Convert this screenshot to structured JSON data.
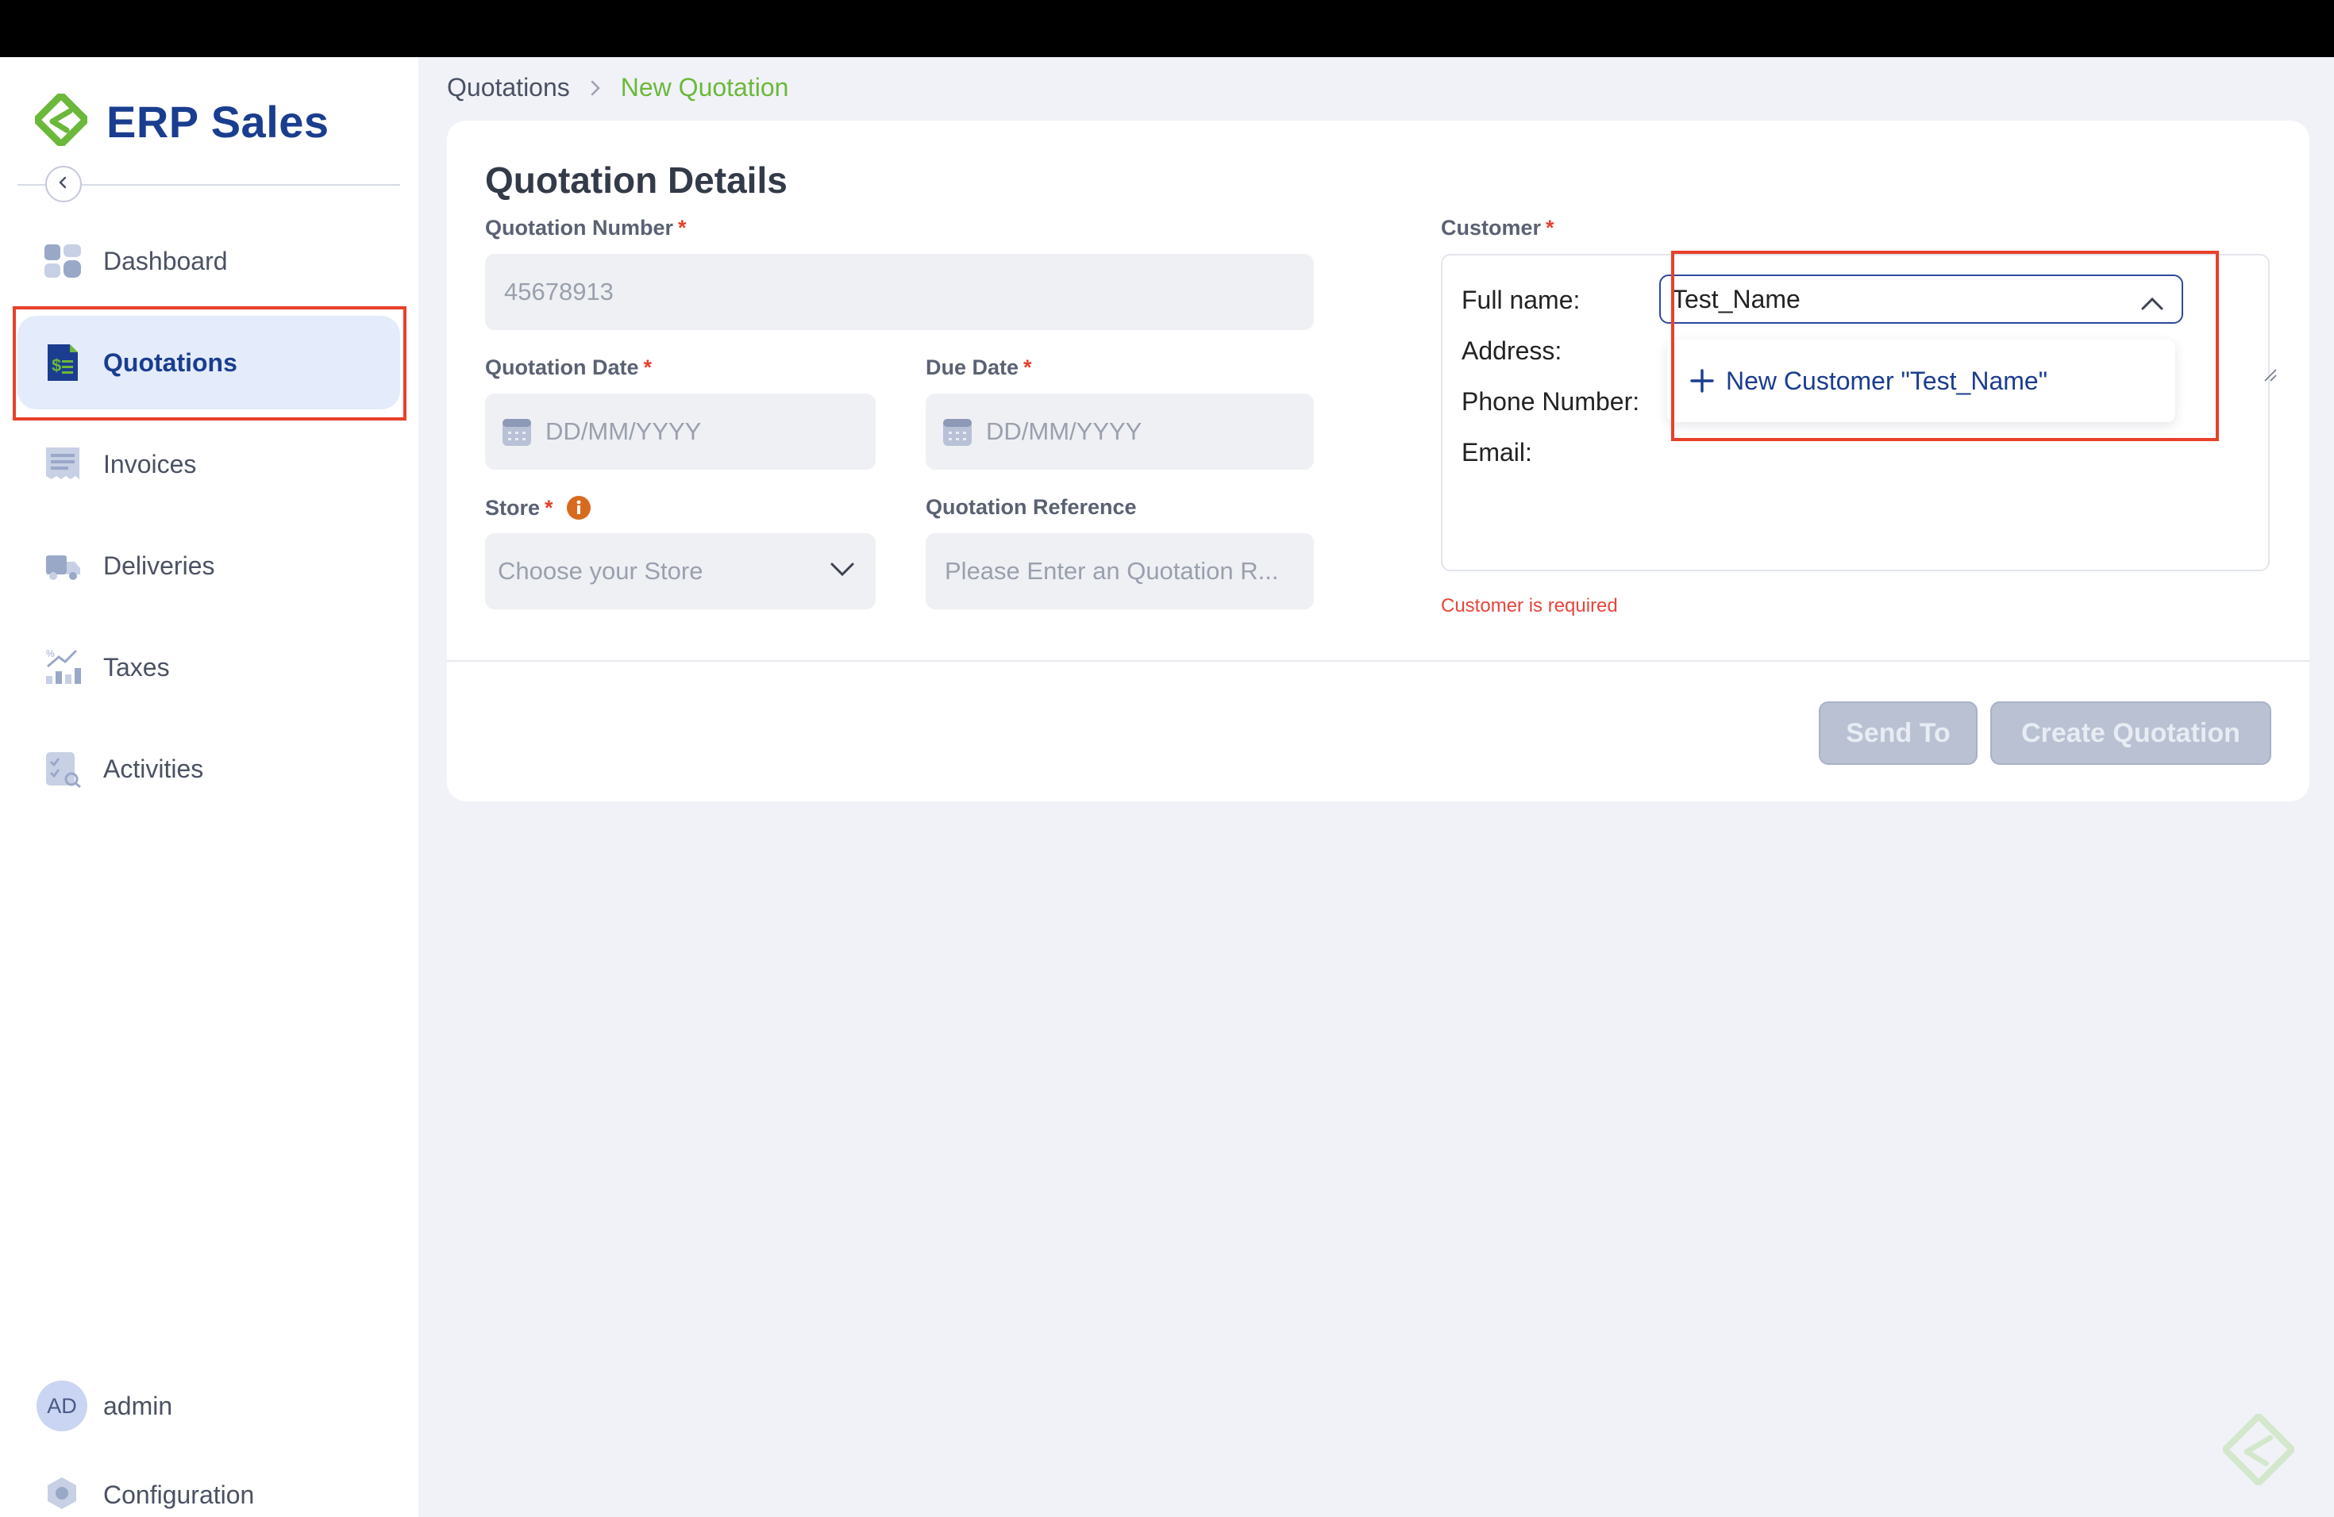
{
  "app": {
    "name": "ERP Sales"
  },
  "sidebar": {
    "items": [
      {
        "label": "Dashboard",
        "icon": "dashboard-icon"
      },
      {
        "label": "Quotations",
        "icon": "quotation-icon",
        "active": true
      },
      {
        "label": "Invoices",
        "icon": "invoice-icon"
      },
      {
        "label": "Deliveries",
        "icon": "truck-icon"
      },
      {
        "label": "Taxes",
        "icon": "tax-chart-icon"
      },
      {
        "label": "Activities",
        "icon": "activity-icon"
      }
    ],
    "user": {
      "initials": "AD",
      "name": "admin"
    },
    "configuration": "Configuration"
  },
  "breadcrumb": {
    "parent": "Quotations",
    "current": "New Quotation"
  },
  "form": {
    "title": "Quotation Details",
    "quotation_number": {
      "label": "Quotation Number",
      "required": "*",
      "value": "45678913"
    },
    "quotation_date": {
      "label": "Quotation Date",
      "required": "*",
      "placeholder": "DD/MM/YYYY"
    },
    "due_date": {
      "label": "Due Date",
      "required": "*",
      "placeholder": "DD/MM/YYYY"
    },
    "store": {
      "label": "Store",
      "required": "*",
      "placeholder": "Choose your Store"
    },
    "quotation_reference": {
      "label": "Quotation Reference",
      "placeholder": "Please Enter an Quotation R..."
    },
    "customer": {
      "label": "Customer",
      "required": "*",
      "full_name_label": "Full name:",
      "full_name_value": "Test_Name",
      "address_label": "Address:",
      "phone_label": "Phone Number:",
      "email_label": "Email:",
      "dropdown_option": "New Customer \"Test_Name\"",
      "error": "Customer is required"
    },
    "buttons": {
      "send_to": "Send To",
      "create": "Create Quotation"
    }
  },
  "colors": {
    "brand_blue": "#1a3d8f",
    "brand_green": "#6bb83a",
    "highlight_red": "#e8402a",
    "error_red": "#e8453c",
    "disabled_button": "#b9c1d3"
  }
}
